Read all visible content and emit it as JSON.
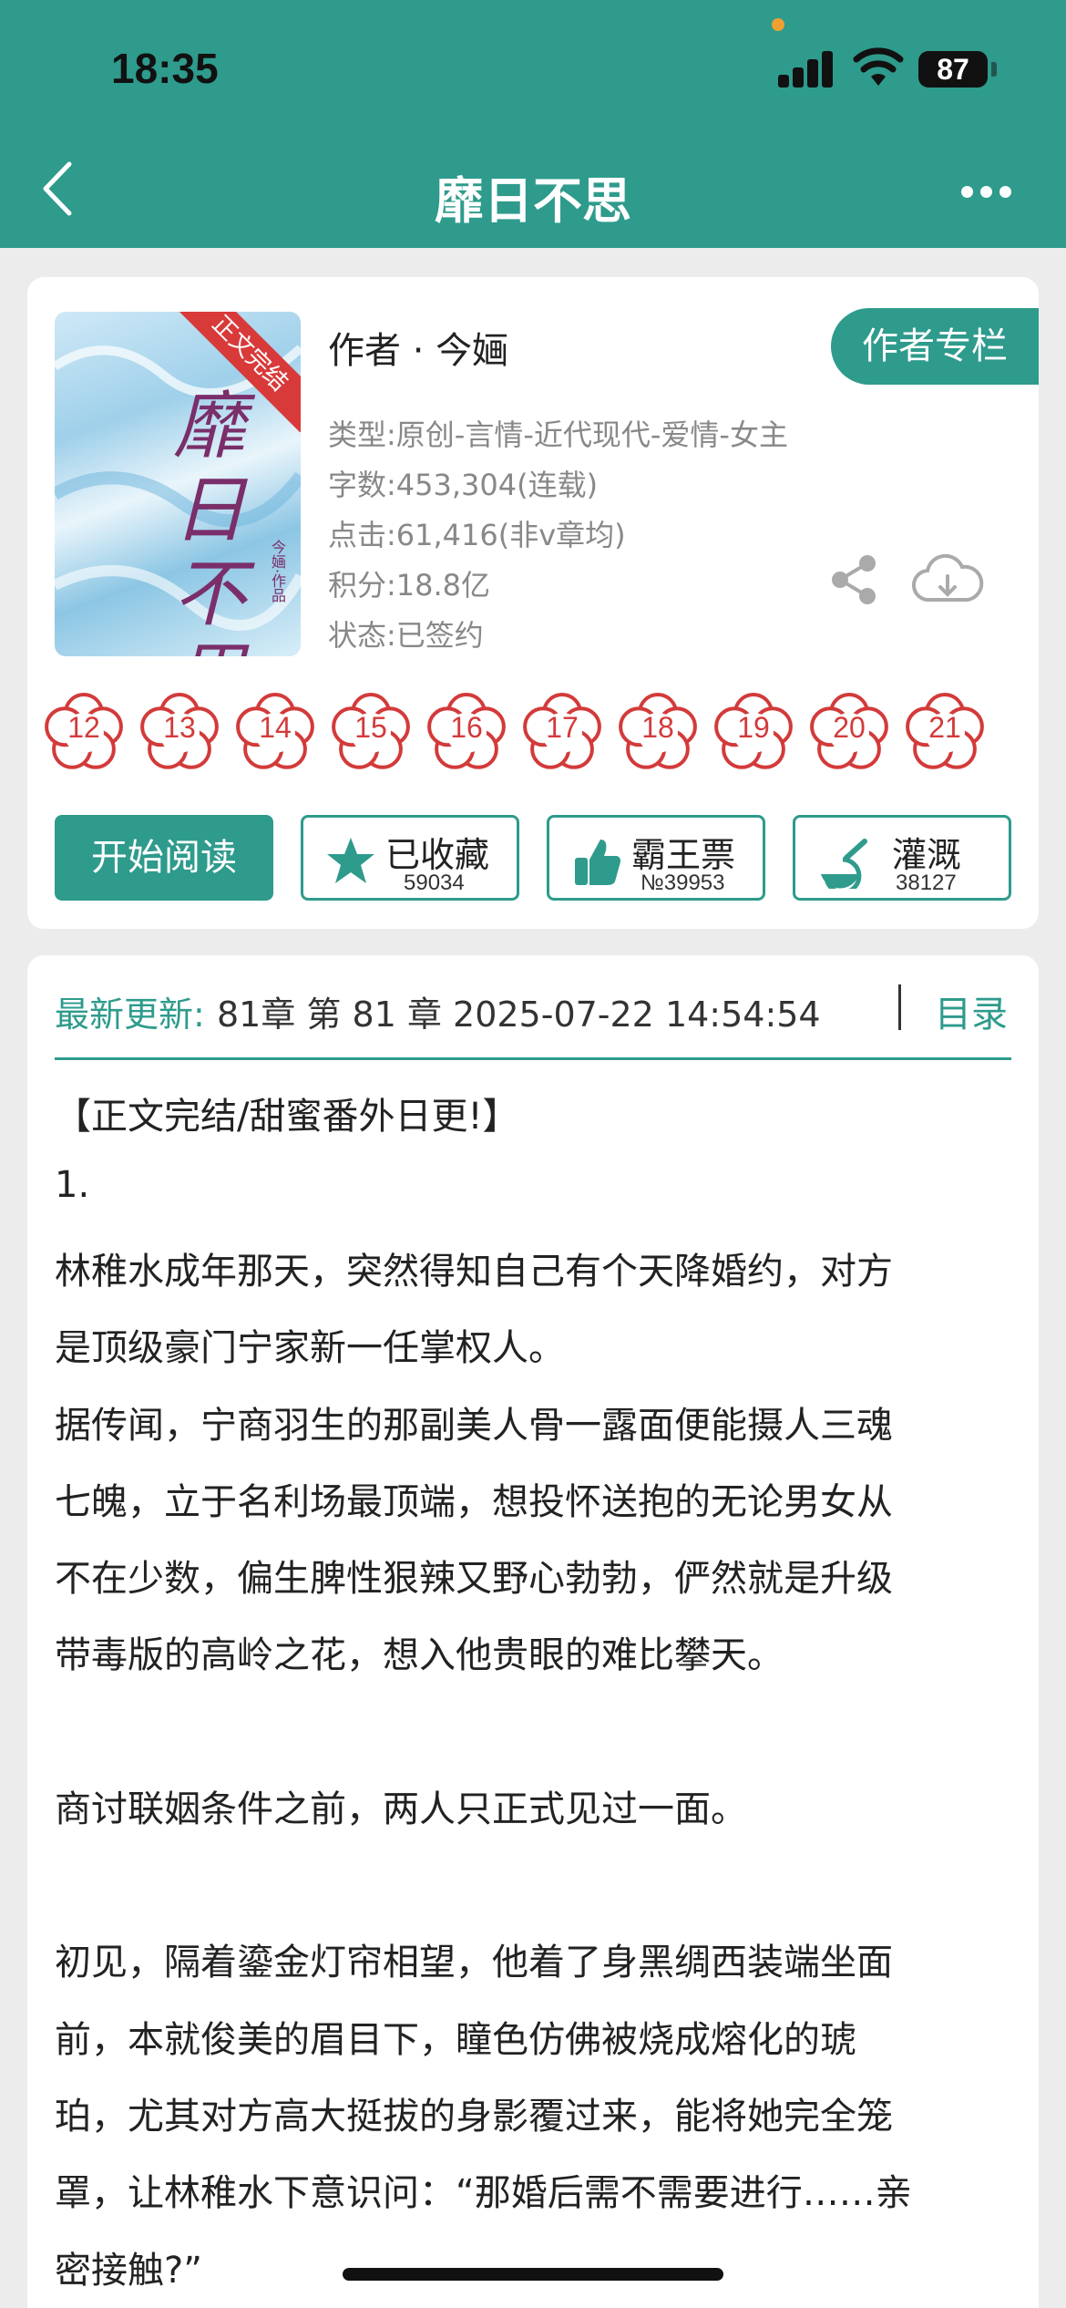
{
  "status_bar": {
    "time": "18:35",
    "battery": "87"
  },
  "nav": {
    "title": "靡日不思"
  },
  "book": {
    "cover_ribbon": "正文完结",
    "cover_title": "靡日不思",
    "cover_author": "今婳·作品",
    "author_line": "作者 · 今婳",
    "author_column_label": "作者专栏",
    "genre": "类型:原创-言情-近代现代-爱情-女主",
    "word_count": "字数:453,304(连载)",
    "clicks": "点击:61,416(非v章均)",
    "points": "积分:18.8亿",
    "status": "状态:已签约"
  },
  "flowers": [
    "12",
    "13",
    "14",
    "15",
    "16",
    "17",
    "18",
    "19",
    "20",
    "21"
  ],
  "actions": {
    "start_read": "开始阅读",
    "favorite": {
      "label": "已收藏",
      "count": "59034"
    },
    "vote": {
      "label": "霸王票",
      "count": "№39953"
    },
    "water": {
      "label": "灌溉",
      "count": "38127"
    }
  },
  "update": {
    "label": "最新更新:",
    "text": "81章 第 81 章 2025-07-22 14:54:54",
    "toc_label": "目录"
  },
  "synopsis": [
    "【正文完结/甜蜜番外日更!】",
    "1.",
    "林稚水成年那天，突然得知自己有个天降婚约，对方",
    "是顶级豪门宁家新一任掌权人。",
    "据传闻，宁商羽生的那副美人骨一露面便能摄人三魂",
    "七魄，立于名利场最顶端，想投怀送抱的无论男女从",
    "不在少数，偏生脾性狠辣又野心勃勃，俨然就是升级",
    "带毒版的高岭之花，想入他贵眼的难比攀天。",
    "商讨联姻条件之前，两人只正式见过一面。",
    "初见，隔着鎏金灯帘相望，他着了身黑绸西装端坐面",
    "前，本就俊美的眉目下，瞳色仿佛被烧成熔化的琥",
    "珀，尤其对方高大挺拔的身影覆过来，能将她完全笼",
    "罩，让林稚水下意识问：“那婚后需不需要进行……亲",
    "密接触?”"
  ],
  "colors": {
    "accent": "#2e9b8c",
    "flower": "#d33a3a"
  }
}
